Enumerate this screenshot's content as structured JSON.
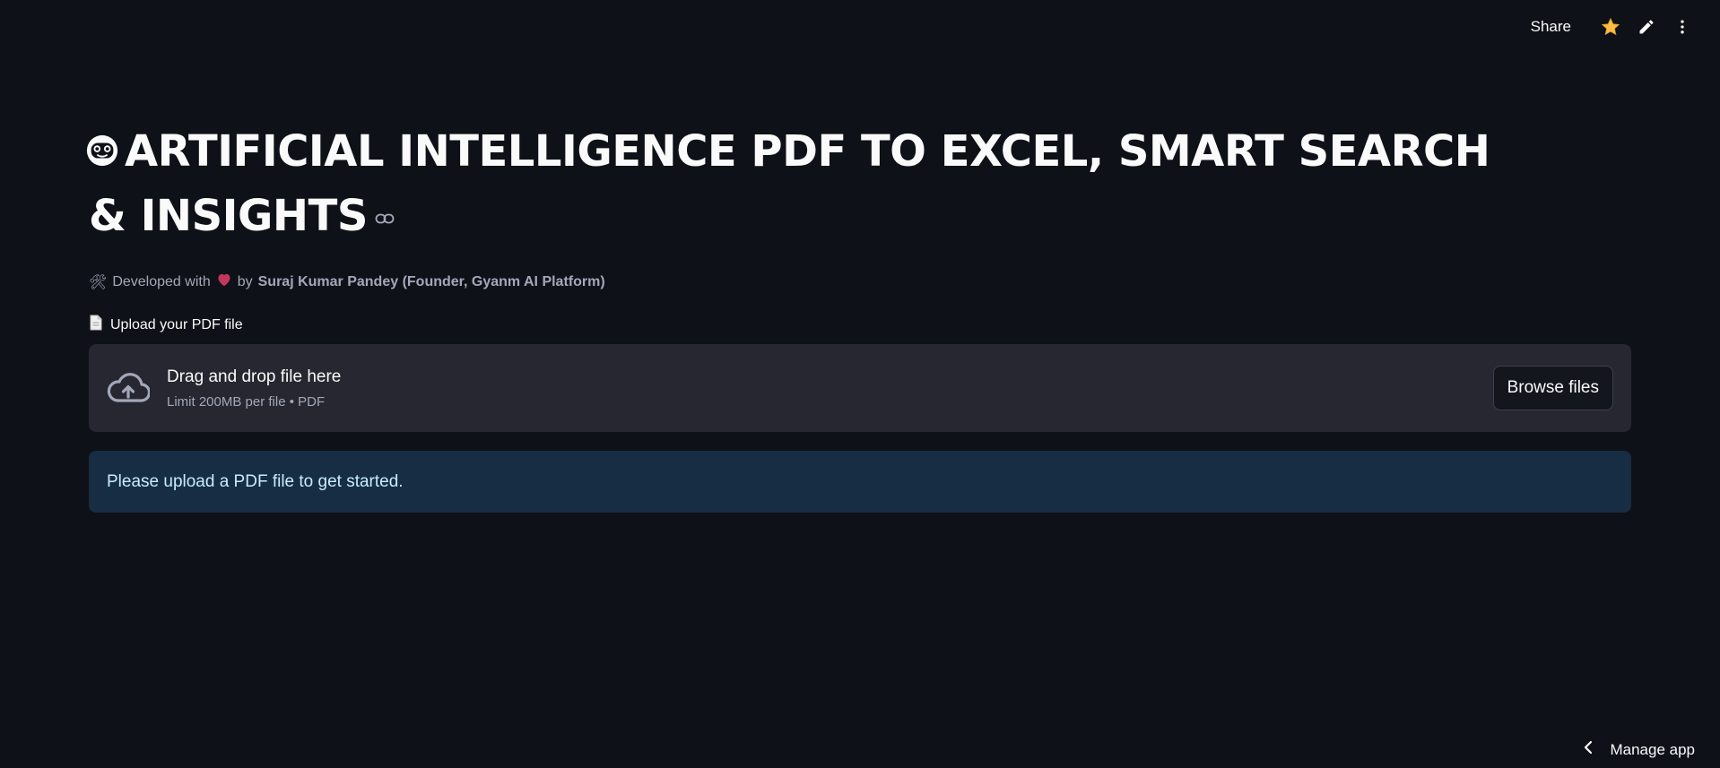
{
  "header": {
    "share_label": "Share",
    "icons": [
      "star-icon",
      "pencil-icon",
      "more-vertical-icon"
    ],
    "star_color": "#ffbd45"
  },
  "main": {
    "title_emoji": "robot-face-icon",
    "title": "ARTIFICIAL INTELLIGENCE PDF TO EXCEL, SMART SEARCH & INSIGHTS",
    "subtitle": {
      "tool_emoji": "🛠",
      "prefix": "Developed with",
      "heart_color": "#c2385c",
      "by_label": "by",
      "author": "Suraj Kumar Pandey (Founder, Gyanm AI Platform)"
    },
    "uploader": {
      "label_emoji": "page-icon",
      "label": "Upload your PDF file",
      "drop_text": "Drag and drop file here",
      "limit_text": "Limit 200MB per file • PDF",
      "browse_label": "Browse files"
    },
    "info_message": "Please upload a PDF file to get started."
  },
  "footer": {
    "manage_label": "Manage app"
  },
  "colors": {
    "background": "#0e1117",
    "dropzone": "#262730",
    "info_bg": "#172d43",
    "info_text": "#c7ebff"
  }
}
